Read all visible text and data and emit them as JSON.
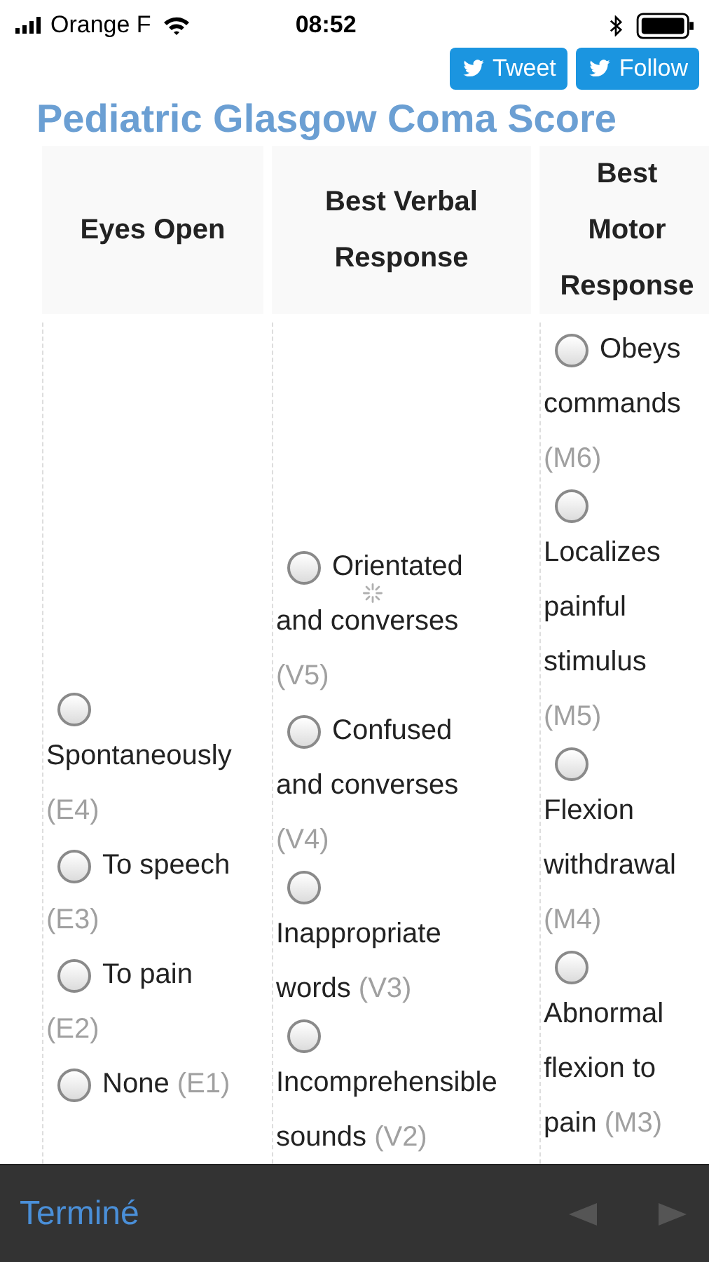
{
  "status_bar": {
    "carrier": "Orange F",
    "time": "08:52"
  },
  "share_buttons": [
    {
      "label": "Tweet"
    },
    {
      "label": "Follow"
    }
  ],
  "title": "Pediatric Glasgow Coma Score",
  "table": {
    "columns": [
      {
        "heading": [
          "Eyes Open"
        ],
        "options": [
          {
            "radio_alone": true,
            "lines": [
              "Spontaneously"
            ],
            "code": "(E4)",
            "code_inline": false,
            "selected": false
          },
          {
            "radio_alone": false,
            "lines": [
              "To speech"
            ],
            "code": "(E3)",
            "code_inline": false,
            "selected": false
          },
          {
            "radio_alone": false,
            "lines": [
              "To pain"
            ],
            "code": "(E2)",
            "code_inline": false,
            "selected": false
          },
          {
            "radio_alone": false,
            "lines": [
              "None"
            ],
            "code": "(E1)",
            "code_inline": true,
            "selected": false
          }
        ]
      },
      {
        "heading": [
          "Best Verbal",
          "Response"
        ],
        "options": [
          {
            "radio_alone": false,
            "lines": [
              "Orientated",
              "and converses"
            ],
            "code": "(V5)",
            "code_inline": false,
            "selected": false
          },
          {
            "radio_alone": false,
            "lines": [
              "Confused",
              "and converses"
            ],
            "code": "(V4)",
            "code_inline": false,
            "selected": false
          },
          {
            "radio_alone": true,
            "lines": [
              "Inappropriate",
              "words"
            ],
            "code": "(V3)",
            "code_inline": true,
            "selected": false
          },
          {
            "radio_alone": true,
            "lines": [
              "Incomprehensible",
              "sounds"
            ],
            "code": "(V2)",
            "code_inline": true,
            "selected": false
          }
        ]
      },
      {
        "heading": [
          "Best",
          "Motor",
          "Response"
        ],
        "options": [
          {
            "radio_alone": false,
            "lines": [
              "Obeys",
              "commands"
            ],
            "code": "(M6)",
            "code_inline": false,
            "selected": false
          },
          {
            "radio_alone": true,
            "lines": [
              "Localizes",
              "painful",
              "stimulus"
            ],
            "code": "(M5)",
            "code_inline": false,
            "selected": false
          },
          {
            "radio_alone": true,
            "lines": [
              "Flexion",
              "withdrawal"
            ],
            "code": "(M4)",
            "code_inline": false,
            "selected": false
          },
          {
            "radio_alone": true,
            "lines": [
              "Abnormal",
              "flexion to",
              "pain"
            ],
            "code": "(M3)",
            "code_inline": true,
            "selected": false
          }
        ]
      }
    ]
  },
  "toolbar": {
    "done": "Terminé",
    "previous": {
      "disabled": true
    },
    "next": {
      "disabled": true
    }
  }
}
